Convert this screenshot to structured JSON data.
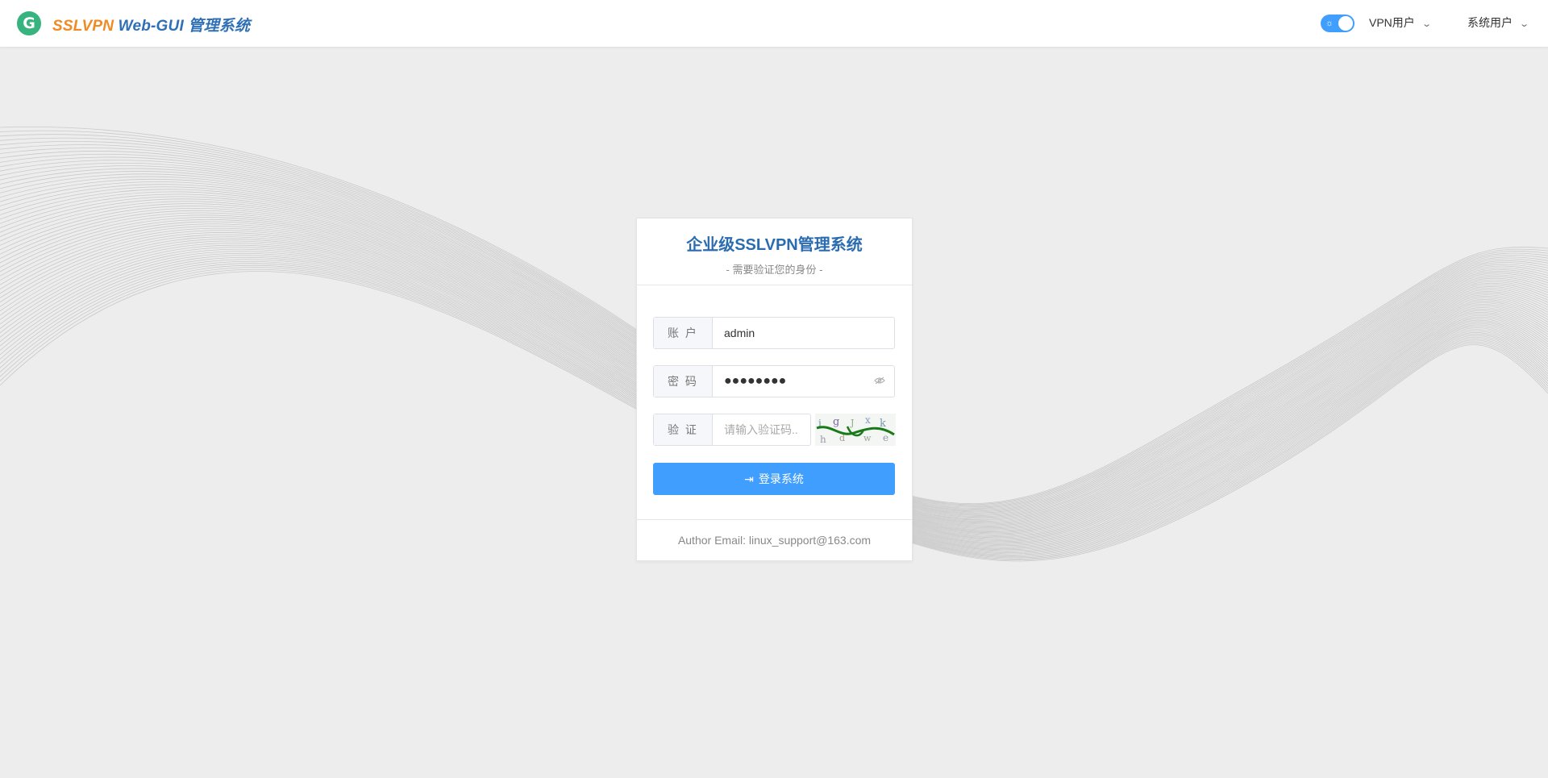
{
  "app": {
    "logo_letter": "G",
    "brand_part1": "SSLVPN",
    "brand_part2": " Web-GUI 管理系统"
  },
  "header": {
    "theme_toggle_icon": "sun-icon",
    "menus": [
      {
        "label": "VPN用户",
        "icon": "chevron-down-icon"
      },
      {
        "label": "系统用户",
        "icon": "chevron-down-icon"
      }
    ]
  },
  "login": {
    "title": "企业级SSLVPN管理系统",
    "subtitle": "- 需要验证您的身份 -",
    "account_label": "账 户",
    "account_value": "admin",
    "password_label": "密 码",
    "password_mask": "●●●●●●●●",
    "verify_label": "验 证",
    "verify_placeholder": "请输入验证码...",
    "submit_label": "登录系统",
    "footer": "Author Email: linux_support@163.com"
  },
  "colors": {
    "primary": "#409eff",
    "title": "#2b6cb0",
    "brand_orange": "#f08a24",
    "brand_blue": "#2f6fb5",
    "logo_green": "#36b37e"
  }
}
